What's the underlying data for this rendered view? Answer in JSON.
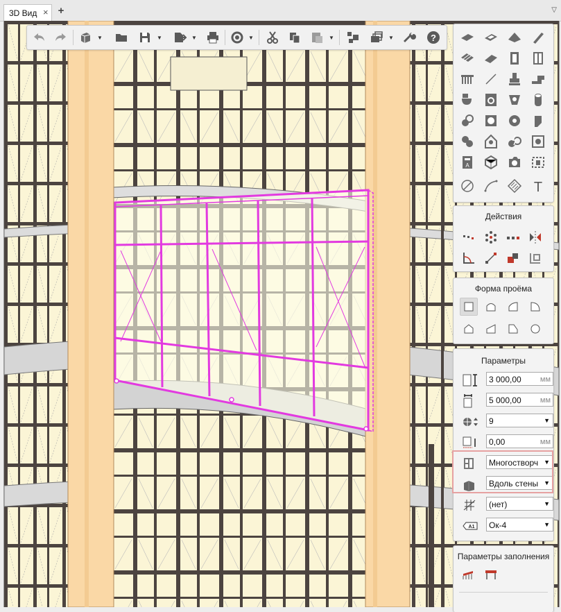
{
  "tab": {
    "label": "3D Вид",
    "close": "×",
    "add": "+",
    "menu": "▽"
  },
  "toolbar": {
    "icons": [
      "undo-icon",
      "redo-icon",
      "3d-box-icon",
      "open-folder-icon",
      "save-icon",
      "export-icon",
      "print-icon",
      "refresh-icon",
      "cut-icon",
      "copy-icon",
      "paste-icon",
      "layers-icon",
      "views-icon",
      "settings-wrench-icon",
      "help-icon"
    ],
    "help_label": "?"
  },
  "actions_panel": {
    "title": "Действия"
  },
  "shape_panel": {
    "title": "Форма проёма"
  },
  "params_panel": {
    "title": "Параметры",
    "height": {
      "value": "3 000,00",
      "unit": "мм"
    },
    "width": {
      "value": "5 000,00",
      "unit": "мм"
    },
    "count": {
      "value": "9"
    },
    "offset": {
      "value": "0,00",
      "unit": "мм"
    },
    "type": {
      "value": "Многостворч"
    },
    "placement": {
      "value": "Вдоль стены"
    },
    "hatch": {
      "value": "(нет)"
    },
    "mark": {
      "value": "Ок-4",
      "badge": "A1"
    }
  },
  "fill_panel": {
    "title": "Параметры заполнения"
  },
  "colors": {
    "selection": "#e23ae0",
    "column": "#fad8a6",
    "frame": "#4c4440",
    "highlight": "#e6a1a1"
  },
  "text_tool": "T"
}
